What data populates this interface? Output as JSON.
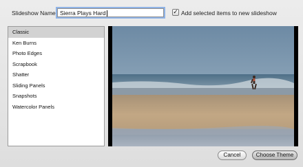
{
  "header": {
    "name_label": "Slideshow Name:",
    "name_value": "Sierra Plays Hard",
    "add_selected_label": "Add selected items to new slideshow",
    "add_selected_checked": true,
    "checkbox_glyph": "✓"
  },
  "themes": {
    "selected": "Classic",
    "items": [
      {
        "label": "Classic"
      },
      {
        "label": "Ken Burns"
      },
      {
        "label": "Photo Edges"
      },
      {
        "label": "Scrapbook"
      },
      {
        "label": "Shatter"
      },
      {
        "label": "Sliding Panels"
      },
      {
        "label": "Snapshots"
      },
      {
        "label": "Watercolor Panels"
      }
    ]
  },
  "buttons": {
    "cancel_label": "Cancel",
    "choose_label": "Choose Theme"
  },
  "colors": {
    "selection": "#d2d2d2",
    "focus_ring": "#8fb3e6"
  }
}
